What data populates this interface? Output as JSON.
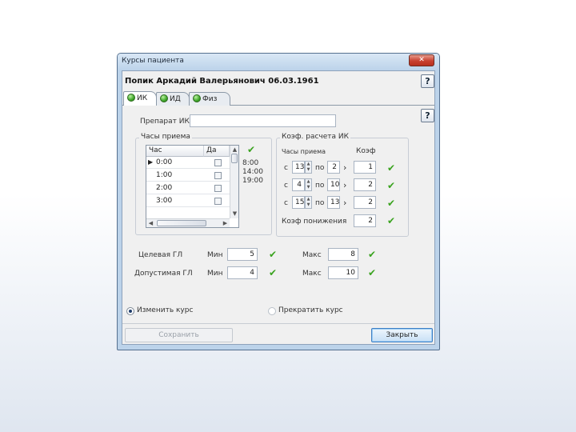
{
  "window": {
    "title": "Курсы пациента",
    "close_glyph": "✕"
  },
  "patient": {
    "name": "Попик Аркадий Валерьянович 06.03.1961"
  },
  "help_glyph": "?",
  "tabs": [
    {
      "label": "ИК",
      "active": true
    },
    {
      "label": "ИД",
      "active": false
    },
    {
      "label": "Физ",
      "active": false
    }
  ],
  "drug": {
    "label": "Препарат ИК",
    "value": ""
  },
  "intake_hours": {
    "title": "Часы приема",
    "columns": [
      "Час",
      "Да"
    ],
    "rows": [
      {
        "hour": "0:00",
        "checked": false,
        "current": true
      },
      {
        "hour": "1:00",
        "checked": false,
        "current": false
      },
      {
        "hour": "2:00",
        "checked": false,
        "current": false
      },
      {
        "hour": "3:00",
        "checked": false,
        "current": false
      }
    ],
    "selected_times": [
      "8:00",
      "14:00",
      "19:00"
    ]
  },
  "coefficients": {
    "title": "Коэф. расчета ИК",
    "col_hour": "Часы приема",
    "col_coef": "Коэф",
    "from_label": "с",
    "to_label": "по",
    "arrow_glyph": "›",
    "rows": [
      {
        "from": "13",
        "to": "2",
        "coef": "1"
      },
      {
        "from": "4",
        "to": "10",
        "coef": "2"
      },
      {
        "from": "15",
        "to": "13",
        "coef": "2"
      }
    ],
    "reduction_label": "Коэф понижения",
    "reduction_value": "2"
  },
  "targets": {
    "target_label": "Целевая ГЛ",
    "allowed_label": "Допустимая ГЛ",
    "min_label": "Мин",
    "max_label": "Макс",
    "target_min": "5",
    "target_max": "8",
    "allowed_min": "4",
    "allowed_max": "10"
  },
  "check_glyph": "✔",
  "actions": {
    "change_course": "Изменить курс",
    "stop_course": "Прекратить курс",
    "save": "Сохранить",
    "close": "Закрыть"
  },
  "colors": {
    "accent": "#3f7fc4",
    "check": "#3aa31f",
    "frame": "#bcd3ea"
  }
}
